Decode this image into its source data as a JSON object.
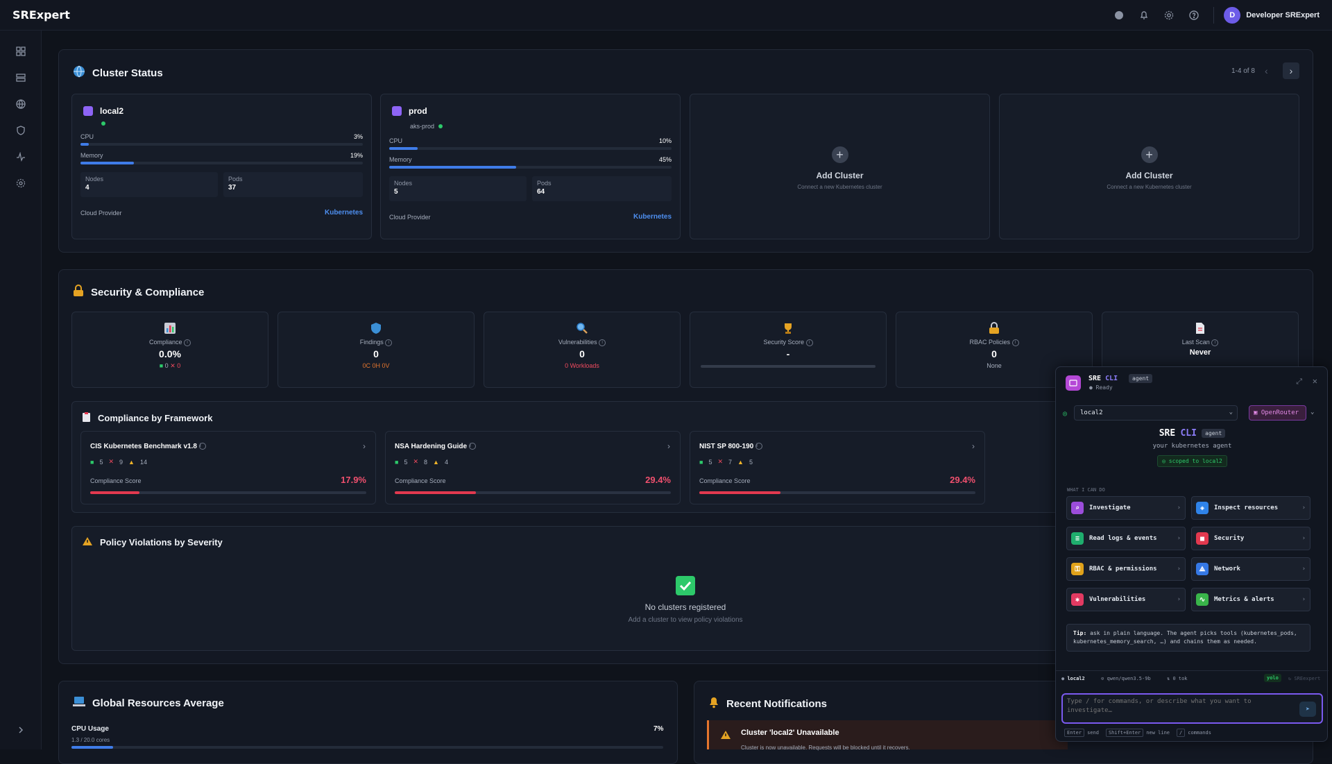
{
  "app": {
    "logo": "SRExpert",
    "user_initial": "D",
    "user_name": "Developer SRExpert"
  },
  "topbar": {
    "icons": [
      "circle-icon",
      "bell-icon",
      "gear-icon",
      "help-icon"
    ]
  },
  "sidebar": {
    "icons": [
      "dashboard-icon",
      "server-icon",
      "globe-icon",
      "shield-icon",
      "activity-icon",
      "settings-icon",
      "chevron-right-icon"
    ]
  },
  "cluster_status": {
    "title": "Cluster Status",
    "pagination": "1-4 of 8",
    "clusters": [
      {
        "name": "local2",
        "sub": "",
        "cpu_label": "CPU",
        "cpu": "3%",
        "cpu_frac": 0.03,
        "mem_label": "Memory",
        "mem": "19%",
        "mem_frac": 0.19,
        "nodes_label": "Nodes",
        "nodes": "4",
        "pods_label": "Pods",
        "pods": "37",
        "provider_label": "Cloud Provider",
        "provider": "Kubernetes"
      },
      {
        "name": "prod",
        "sub": "aks-prod",
        "cpu_label": "CPU",
        "cpu": "10%",
        "cpu_frac": 0.1,
        "mem_label": "Memory",
        "mem": "45%",
        "mem_frac": 0.45,
        "nodes_label": "Nodes",
        "nodes": "5",
        "pods_label": "Pods",
        "pods": "64",
        "provider_label": "Cloud Provider",
        "provider": "Kubernetes"
      }
    ],
    "add": [
      {
        "title": "Add Cluster",
        "sub": "Connect a new Kubernetes cluster"
      },
      {
        "title": "Add Cluster",
        "sub": "Connect a new Kubernetes cluster"
      }
    ]
  },
  "security": {
    "title": "Security & Compliance",
    "metrics": [
      {
        "label": "Compliance",
        "value": "0.0%",
        "extra_a": "0",
        "extra_b": "0"
      },
      {
        "label": "Findings",
        "value": "0",
        "sub": "0C 0H 0V"
      },
      {
        "label": "Vulnerabilities",
        "value": "0",
        "sub": "0 Workloads"
      },
      {
        "label": "Security Score",
        "value": "-"
      },
      {
        "label": "RBAC Policies",
        "value": "0",
        "sub": "None"
      },
      {
        "label": "Last Scan",
        "value": "Never"
      }
    ]
  },
  "frameworks": {
    "title": "Compliance by Framework",
    "score_label": "Compliance Score",
    "items": [
      {
        "name": "CIS Kubernetes Benchmark v1.8",
        "pass": "5",
        "fail": "9",
        "warn": "14",
        "pct": "17.9%",
        "frac": 0.179
      },
      {
        "name": "NSA Hardening Guide",
        "pass": "5",
        "fail": "8",
        "warn": "4",
        "pct": "29.4%",
        "frac": 0.294
      },
      {
        "name": "NIST SP 800-190",
        "pass": "5",
        "fail": "7",
        "warn": "5",
        "pct": "29.4%",
        "frac": 0.294
      }
    ]
  },
  "violations": {
    "title": "Policy Violations by Severity",
    "empty_title": "No clusters registered",
    "empty_sub": "Add a cluster to view policy violations"
  },
  "global": {
    "title": "Global Resources Average",
    "cpu_label": "CPU Usage",
    "cpu_value": "7%",
    "cpu_sub": "1.3 / 20.0 cores"
  },
  "notifications": {
    "title": "Recent Notifications",
    "item_title": "Cluster 'local2' Unavailable",
    "item_sub": "Cluster is now unavailable. Requests will be blocked until it recovers."
  },
  "chat": {
    "title_a": "SRE",
    "title_b": "CLI",
    "badge": "agent",
    "status": "Ready",
    "cluster": "local2",
    "provider": "OpenRouter",
    "hero_a": "SRE",
    "hero_b": "CLI",
    "hero_badge": "agent",
    "hero_sub": "your kubernetes agent",
    "scope": "scoped to local2",
    "section": "WHAT I CAN DO",
    "actions": [
      {
        "label": "Investigate",
        "color": "#9b4ddb"
      },
      {
        "label": "Inspect resources",
        "color": "#2f83e8"
      },
      {
        "label": "Read logs & events",
        "color": "#1fae6e"
      },
      {
        "label": "Security",
        "color": "#e2394f"
      },
      {
        "label": "RBAC & permissions",
        "color": "#e0a21a"
      },
      {
        "label": "Network",
        "color": "#3578e5"
      },
      {
        "label": "Vulnerabilities",
        "color": "#e23a62"
      },
      {
        "label": "Metrics & alerts",
        "color": "#39b54a"
      }
    ],
    "tip_label": "Tip:",
    "tip": "ask in plain language. The agent picks tools (kubernetes_pods, kubernetes_memory_search, …) and chains them as needed.",
    "status_cluster": "local2",
    "status_model": "qwen/qwen3.5-9b",
    "status_tok": "0 tok",
    "status_mode": "yolo",
    "status_brand": "SREexpert",
    "placeholder": "Type / for commands, or describe what you want to investigate…",
    "hint_enter": "Enter",
    "hint_send": "send",
    "hint_shift": "Shift+Enter",
    "hint_newline": "new line",
    "hint_slash": "/",
    "hint_cmd": "commands"
  }
}
